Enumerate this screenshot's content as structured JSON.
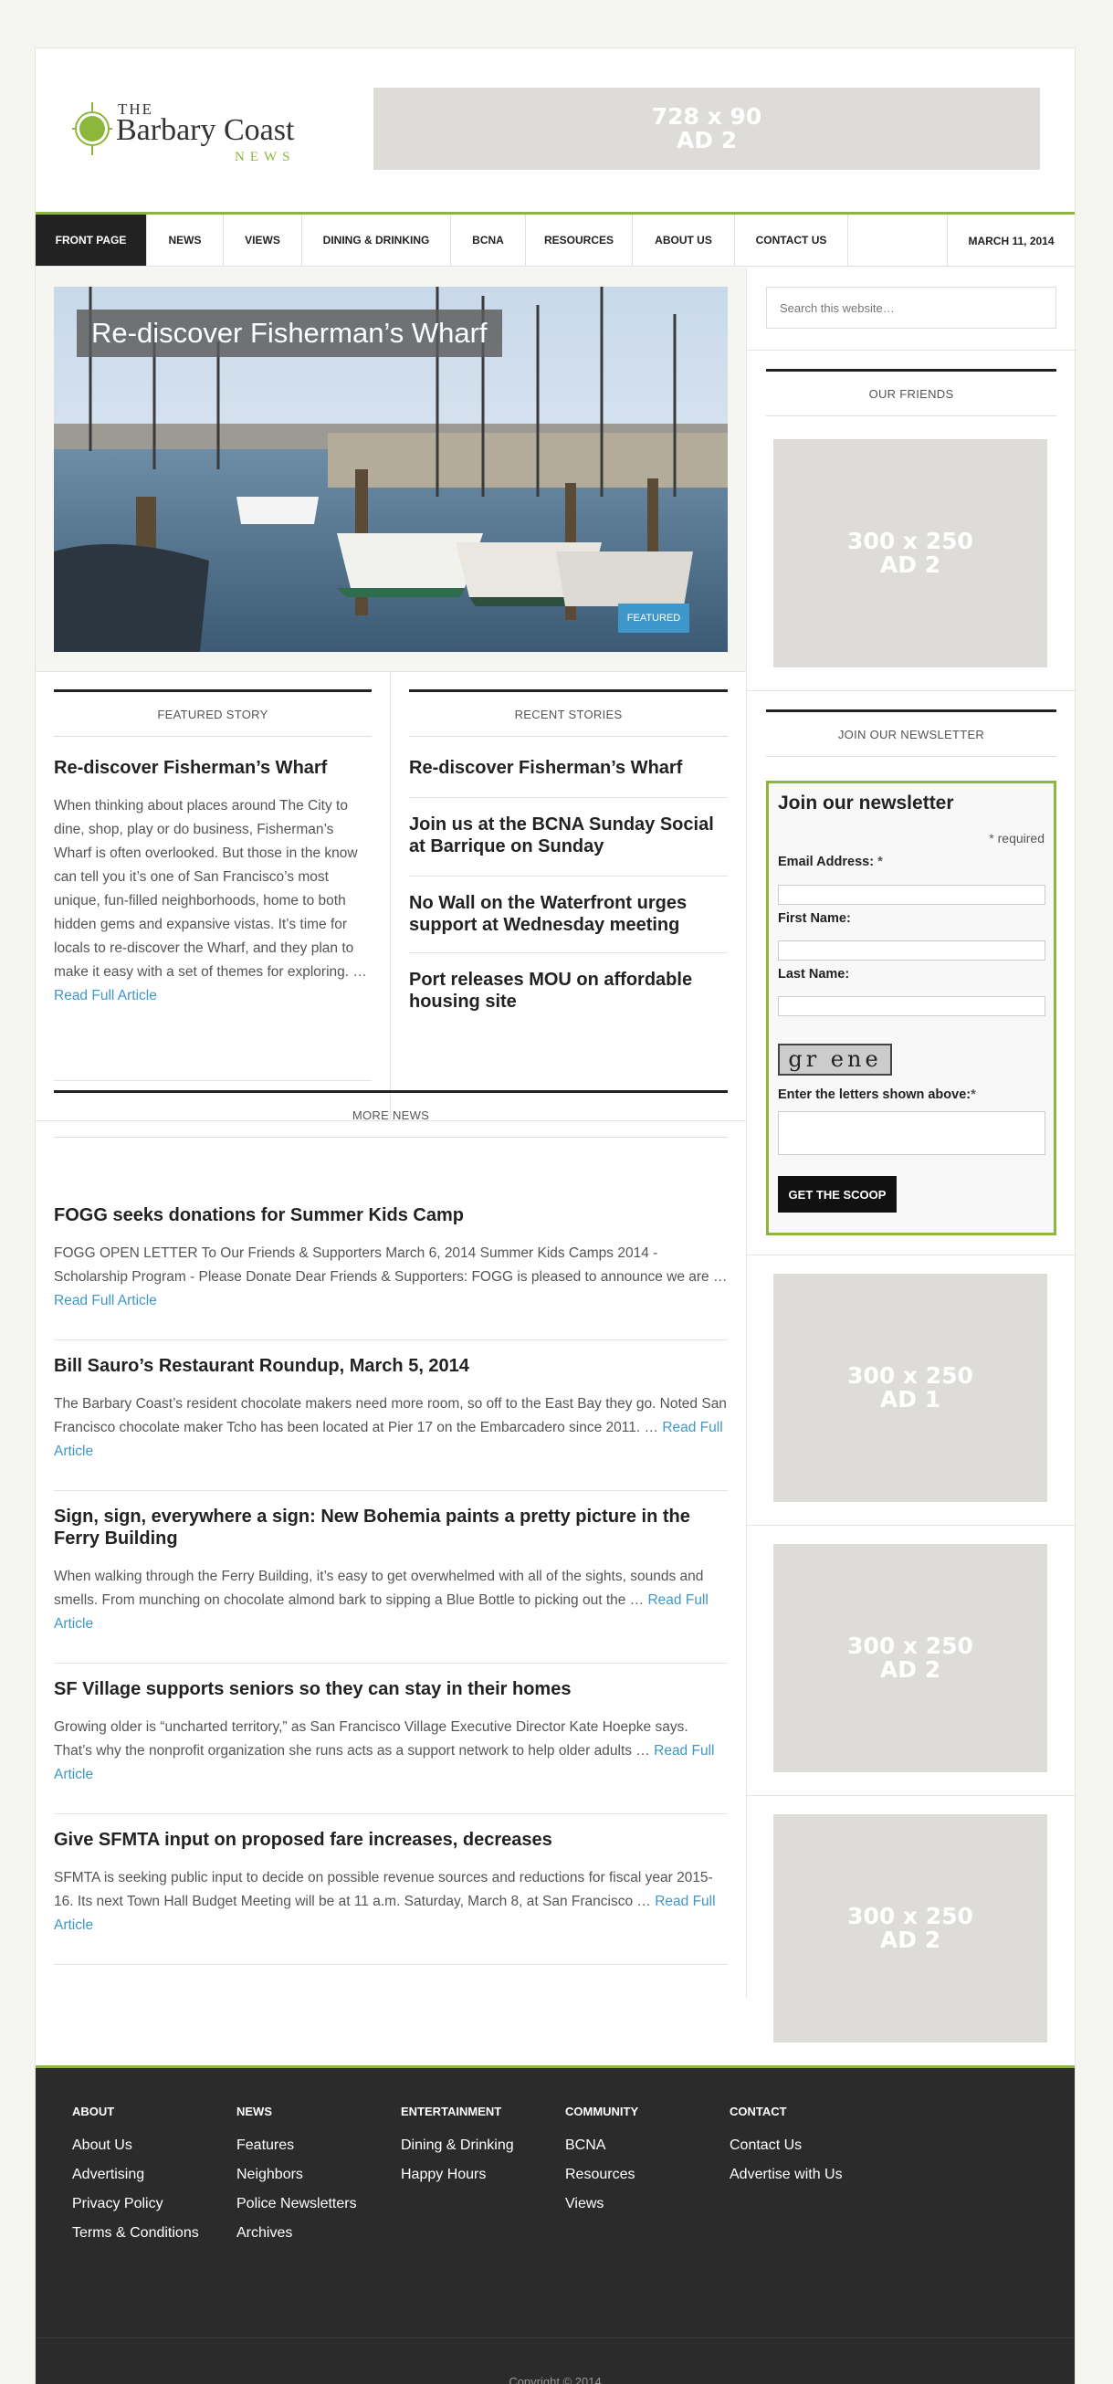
{
  "brand": {
    "logo_the": "THE",
    "logo_main": "Barbary Coast",
    "logo_news": "NEWS",
    "accent": "#8db63c",
    "link_color": "#3f97c9"
  },
  "ads": {
    "top": {
      "size": "728 x 90",
      "label": "AD 2"
    },
    "friends": {
      "size": "300 x 250",
      "label": "AD 2"
    },
    "side1": {
      "size": "300 x 250",
      "label": "AD 1"
    },
    "side2": {
      "size": "300 x 250",
      "label": "AD 2"
    },
    "side3": {
      "size": "300 x 250",
      "label": "AD 2"
    }
  },
  "nav": {
    "items": [
      "FRONT PAGE",
      "NEWS",
      "VIEWS",
      "DINING & DRINKING",
      "BCNA",
      "RESOURCES",
      "ABOUT US",
      "CONTACT US"
    ],
    "date": "MARCH 11, 2014"
  },
  "hero": {
    "title": "Re-discover Fisherman’s Wharf",
    "tag": "FEATURED"
  },
  "featured": {
    "heading": "FEATURED STORY",
    "title": "Re-discover Fisherman’s Wharf",
    "excerpt": "When thinking about places around The City to dine, shop, play or do business, Fisherman’s Wharf is often overlooked. But those in the know can tell you it’s one of San Francisco’s most unique, fun-filled neighborhoods, home to both hidden gems and expansive vistas. It’s time for locals to re-discover the Wharf, and they plan to make it easy with a set of themes for exploring. …",
    "read_more": "Read Full Article"
  },
  "recent": {
    "heading": "RECENT STORIES",
    "items": [
      "Re-discover Fisherman’s Wharf",
      "Join us at the BCNA Sunday Social at Barrique on Sunday",
      "No Wall on the Waterfront urges support at Wednesday meeting",
      "Port releases MOU on affordable housing site"
    ]
  },
  "more": {
    "heading": "MORE NEWS",
    "items": [
      {
        "title": "FOGG seeks donations for Summer Kids Camp",
        "excerpt": "FOGG OPEN LETTER To Our Friends & Supporters March 6, 2014 Summer Kids Camps 2014 - Scholarship Program - Please Donate Dear Friends & Supporters: FOGG is pleased to announce we are …",
        "read_more": "Read Full Article"
      },
      {
        "title": "Bill Sauro’s Restaurant Roundup, March 5, 2014",
        "excerpt": "The Barbary Coast’s resident chocolate makers need more room, so off to the East Bay they go. Noted San Francisco chocolate maker Tcho has been located at Pier 17 on the Embarcadero since 2011. …",
        "read_more": "Read Full Article"
      },
      {
        "title": "Sign, sign, everywhere a sign: New Bohemia paints a pretty picture in the Ferry Building",
        "excerpt": "When walking through the Ferry Building, it’s easy to get overwhelmed with all of the sights, sounds and smells. From munching on chocolate almond bark to sipping a Blue Bottle to picking out the …",
        "read_more": "Read Full Article"
      },
      {
        "title": "SF Village supports seniors so they can stay in their homes",
        "excerpt": "Growing older is “uncharted territory,” as San Francisco Village Executive Director Kate Hoepke says. That’s why the nonprofit organization she runs acts as a support network to help older adults …",
        "read_more": "Read Full Article"
      },
      {
        "title": "Give SFMTA input on proposed fare increases, decreases",
        "excerpt": "SFMTA is seeking public input to decide on possible revenue sources and reductions for fiscal year 2015-16. Its next Town Hall Budget Meeting will be at 11 a.m. Saturday, March 8, at San Francisco …",
        "read_more": "Read Full Article"
      }
    ]
  },
  "sidebar": {
    "search_placeholder": "Search this website…",
    "friends_heading": "OUR FRIENDS",
    "newsletter_heading": "JOIN OUR NEWSLETTER"
  },
  "newsletter": {
    "title": "Join our newsletter",
    "required": "* required",
    "email_label": "Email Address:",
    "email_star": "*",
    "first_label": "First Name:",
    "last_label": "Last Name:",
    "captcha_text": "gr ene",
    "captcha_label": "Enter the letters shown above:",
    "captcha_star": "*",
    "button": "GET THE SCOOP"
  },
  "footer": {
    "columns": [
      {
        "heading": "ABOUT",
        "links": [
          "About Us",
          "Advertising",
          "Privacy Policy",
          "Terms & Conditions"
        ]
      },
      {
        "heading": "NEWS",
        "links": [
          "Features",
          "Neighbors",
          "Police Newsletters",
          "Archives"
        ]
      },
      {
        "heading": "ENTERTAINMENT",
        "links": [
          "Dining & Drinking",
          "Happy Hours"
        ]
      },
      {
        "heading": "COMMUNITY",
        "links": [
          "BCNA",
          "Resources",
          "Views"
        ]
      },
      {
        "heading": "CONTACT",
        "links": [
          "Contact Us",
          "Advertise with Us"
        ]
      }
    ],
    "copyright": "Copyright © 2014"
  }
}
